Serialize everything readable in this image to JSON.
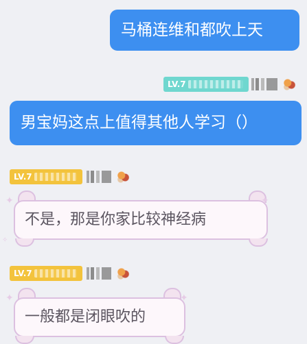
{
  "messages": [
    {
      "side": "right",
      "text": "马桶连维和都吹上天"
    },
    {
      "side": "right",
      "sender_level": "LV.7",
      "sender_title": "",
      "sender_name": "",
      "text": "男宝妈这点上值得其他人学习（）"
    },
    {
      "side": "left",
      "sender_level": "LV.7",
      "sender_title": "",
      "sender_name": "",
      "text": "不是，那是你家比较神经病"
    },
    {
      "side": "left",
      "sender_level": "LV.7",
      "sender_title": "",
      "sender_name": "",
      "text": "一般都是闭眼吹的"
    }
  ],
  "colors": {
    "background": "#eff0f4",
    "own_bubble": "#3d8ff0",
    "tag_teal": "#6fd7cf",
    "tag_gold": "#f3c33c",
    "cute_bubble_border": "#dcc0e0",
    "cute_bubble_text": "#5b5560"
  },
  "icons": [
    "avatar-emoji-icon",
    "star-decoration-icon"
  ]
}
